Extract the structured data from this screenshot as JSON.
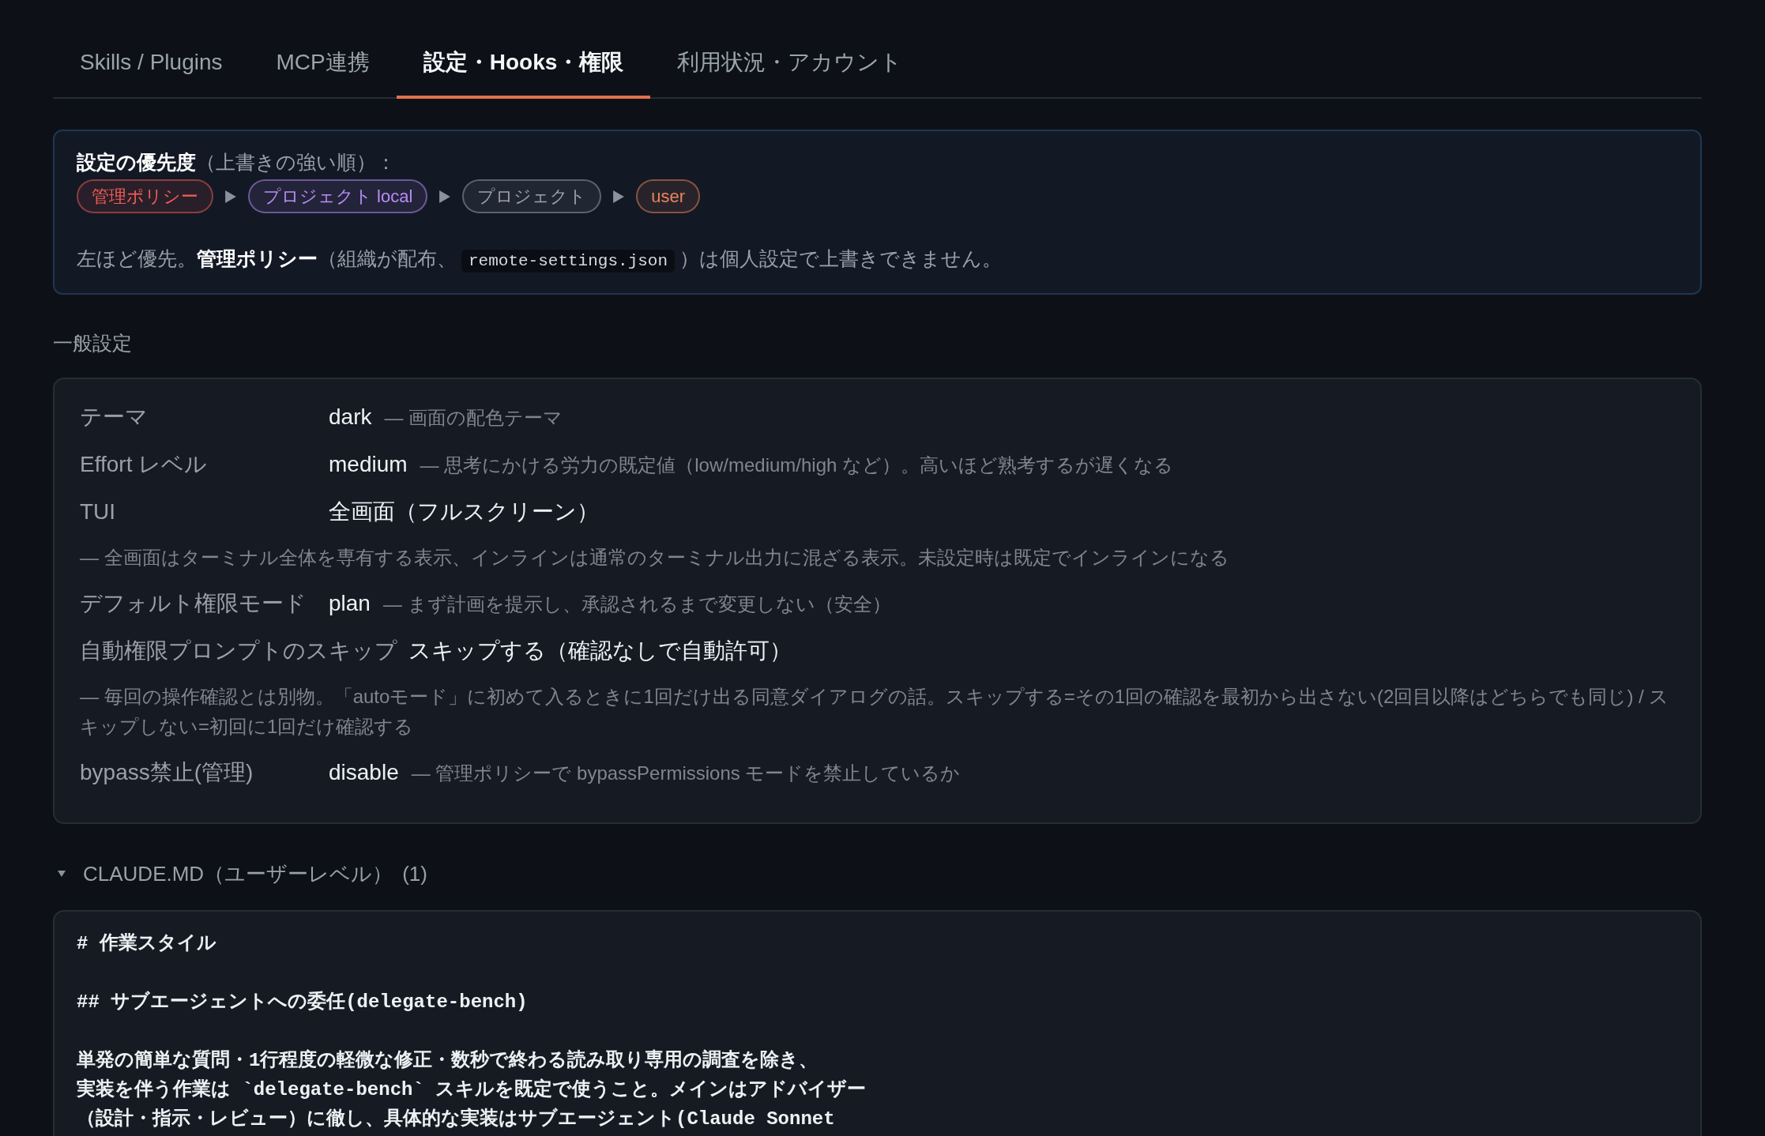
{
  "tabs": [
    {
      "label": "Skills / Plugins",
      "selected": false
    },
    {
      "label": "MCP連携",
      "selected": false
    },
    {
      "label": "設定・Hooks・権限",
      "selected": true
    },
    {
      "label": "利用状況・アカウント",
      "selected": false
    }
  ],
  "priority": {
    "title": "**設定の優先度**（上書きの強い順）：",
    "levels": [
      {
        "label": "管理ポリシー",
        "color": "#f25c54"
      },
      {
        "label": "プロジェクト local",
        "color": "#b98cf5"
      },
      {
        "label": "プロジェクト",
        "color": "#9aa0a8"
      },
      {
        "label": "user",
        "color": "#e8845c"
      }
    ],
    "note": {
      "before": "左ほど優先。**管理ポリシー**（組織が配布、",
      "code": "remote-settings.json",
      "after": "）は個人設定で上書きできません。"
    }
  },
  "general_settings": {
    "title": "一般設定",
    "rows": [
      {
        "kind": "inline",
        "label": "テーマ",
        "value": "dark",
        "description": "— 画面の配色テーマ"
      },
      {
        "kind": "inline",
        "label": "Effort レベル",
        "value": "medium",
        "description": "— 思考にかける労力の既定値（low/medium/high など）。高いほど熟考するが遅くなる"
      },
      {
        "kind": "below",
        "label": "TUI",
        "value": "全画面（フルスクリーン）",
        "description": "— 全画面はターミナル全体を専有する表示、インラインは通常のターミナル出力に混ざる表示。未設定時は既定でインラインになる"
      },
      {
        "kind": "inline",
        "label": "デフォルト権限モード",
        "value": "plan",
        "description": "— まず計画を提示し、承認されるまで変更しない（安全）"
      },
      {
        "kind": "below",
        "label": "自動権限プロンプトのスキップ",
        "value": "スキップする（確認なしで自動許可）",
        "description": "— 毎回の操作確認とは別物。「autoモード」に初めて入るときに1回だけ出る同意ダイアログの話。スキップする=その1回の確認を最初から出さない(2回目以降はどちらでも同じ) / スキップしない=初回に1回だけ確認する"
      },
      {
        "kind": "inline",
        "label": "bypass禁止(管理)",
        "value": "disable",
        "description": "— 管理ポリシーで bypassPermissions モードを禁止しているか"
      }
    ]
  },
  "claude_md": {
    "title": "CLAUDE.MD（ユーザーレベル）",
    "count": "(1)",
    "expanded": true,
    "blocks": [
      [
        "# 作業スタイル"
      ],
      [
        "## サブエージェントへの委任(delegate-bench)"
      ],
      [
        "単発の簡単な質問・1行程度の軽微な修正・数秒で終わる読み取り専用の調査を除き、",
        "実装を伴う作業は `delegate-bench` スキルを既定で使うこと。メインはアドバイザー",
        "（設計・指示・レビュー）に徹し、具体的な実装はサブエージェント(Claude Sonnet"
      ]
    ]
  }
}
